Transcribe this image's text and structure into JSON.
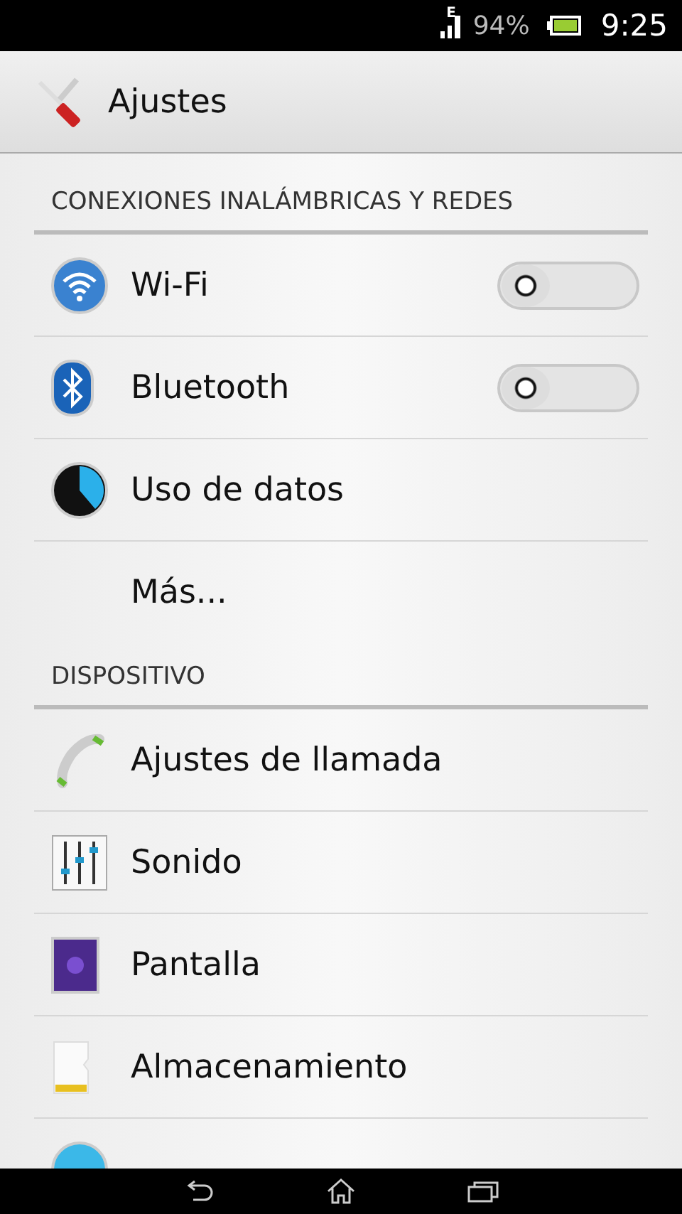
{
  "status_bar": {
    "network": "E",
    "battery": "94%",
    "time": "9:25"
  },
  "action_bar": {
    "title": "Ajustes"
  },
  "sections": [
    {
      "header": "CONEXIONES INALÁMBRICAS Y REDES",
      "items": [
        {
          "kind": "toggle",
          "label": "Wi-Fi",
          "on": false
        },
        {
          "kind": "toggle",
          "label": "Bluetooth",
          "on": false
        },
        {
          "kind": "link",
          "label": "Uso de datos"
        },
        {
          "kind": "link",
          "label": "Más..."
        }
      ]
    },
    {
      "header": "DISPOSITIVO",
      "items": [
        {
          "kind": "link",
          "label": "Ajustes de llamada"
        },
        {
          "kind": "link",
          "label": "Sonido"
        },
        {
          "kind": "link",
          "label": "Pantalla"
        },
        {
          "kind": "link",
          "label": "Almacenamiento"
        },
        {
          "kind": "cut"
        }
      ]
    }
  ]
}
